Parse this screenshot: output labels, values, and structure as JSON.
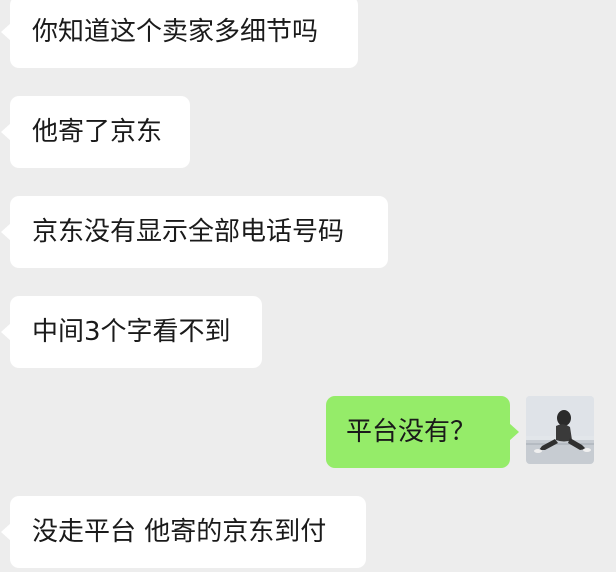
{
  "messages": [
    {
      "side": "left",
      "text": "你知道这个卖家多细节吗"
    },
    {
      "side": "left",
      "text": "他寄了京东"
    },
    {
      "side": "left",
      "text": "京东没有显示全部电话号码"
    },
    {
      "side": "left",
      "text": "中间3个字看不到"
    },
    {
      "side": "right",
      "text": "平台没有？"
    },
    {
      "side": "left",
      "text": "没走平台 他寄的京东到付"
    }
  ],
  "colors": {
    "background": "#ededed",
    "incoming_bubble": "#ffffff",
    "outgoing_bubble": "#95ec69",
    "text": "#1a1a1a"
  },
  "icons": {
    "sender_avatar": "user-avatar-photo"
  }
}
